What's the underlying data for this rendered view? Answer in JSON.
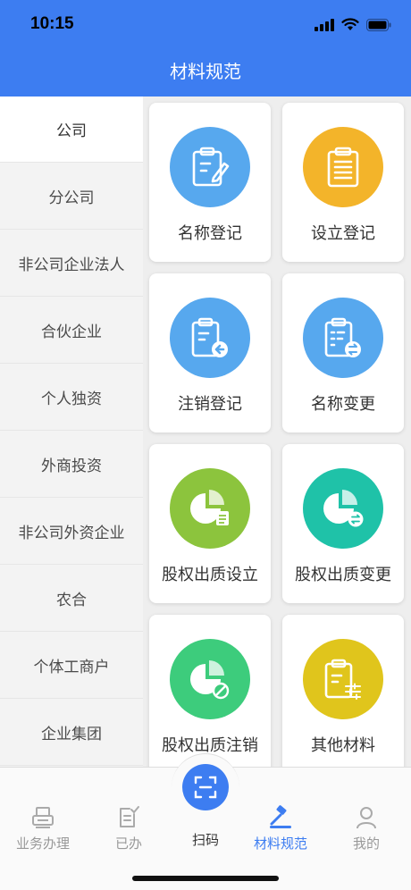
{
  "status": {
    "time": "10:15"
  },
  "header": {
    "title": "材料规范"
  },
  "sidebar": {
    "items": [
      {
        "label": "公司"
      },
      {
        "label": "分公司"
      },
      {
        "label": "非公司企业法人"
      },
      {
        "label": "合伙企业"
      },
      {
        "label": "个人独资"
      },
      {
        "label": "外商投资"
      },
      {
        "label": "非公司外资企业"
      },
      {
        "label": "农合"
      },
      {
        "label": "个体工商户"
      },
      {
        "label": "企业集团"
      }
    ],
    "active_index": 0
  },
  "cards": [
    {
      "label": "名称登记",
      "icon": "clipboard-edit-icon",
      "color": "#57a8ee"
    },
    {
      "label": "设立登记",
      "icon": "clipboard-list-icon",
      "color": "#f3b42a"
    },
    {
      "label": "注销登记",
      "icon": "clipboard-undo-icon",
      "color": "#57a8ee"
    },
    {
      "label": "名称变更",
      "icon": "clipboard-swap-icon",
      "color": "#57a8ee"
    },
    {
      "label": "股权出质设立",
      "icon": "pie-chart-doc-icon",
      "color": "#8cc43d"
    },
    {
      "label": "股权出质变更",
      "icon": "pie-chart-swap-icon",
      "color": "#1fc2a8"
    },
    {
      "label": "股权出质注销",
      "icon": "pie-chart-cancel-icon",
      "color": "#3dcc7c"
    },
    {
      "label": "其他材料",
      "icon": "clipboard-settings-icon",
      "color": "#e0c51c"
    }
  ],
  "tabbar": {
    "tabs": [
      {
        "label": "业务办理",
        "icon": "printer-icon"
      },
      {
        "label": "已办",
        "icon": "done-list-icon"
      },
      {
        "label": "扫码",
        "icon": "scan-icon"
      },
      {
        "label": "材料规范",
        "icon": "gavel-icon"
      },
      {
        "label": "我的",
        "icon": "user-icon"
      }
    ],
    "active_color": "#3d7df1"
  }
}
